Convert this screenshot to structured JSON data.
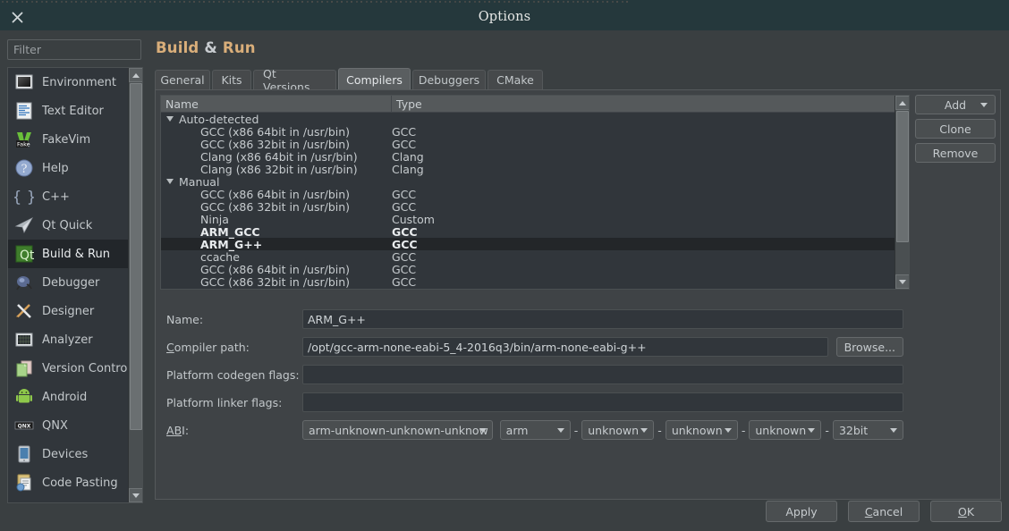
{
  "window": {
    "title": "Options",
    "close_icon": "close-icon"
  },
  "sidebar": {
    "filter_placeholder": "Filter",
    "items": [
      {
        "label": "Environment",
        "icon": "environment-icon"
      },
      {
        "label": "Text Editor",
        "icon": "text-editor-icon"
      },
      {
        "label": "FakeVim",
        "icon": "fakevim-icon"
      },
      {
        "label": "Help",
        "icon": "help-icon"
      },
      {
        "label": "C++",
        "icon": "cpp-icon"
      },
      {
        "label": "Qt Quick",
        "icon": "qt-quick-icon"
      },
      {
        "label": "Build & Run",
        "icon": "build-run-icon"
      },
      {
        "label": "Debugger",
        "icon": "debugger-icon"
      },
      {
        "label": "Designer",
        "icon": "designer-icon"
      },
      {
        "label": "Analyzer",
        "icon": "analyzer-icon"
      },
      {
        "label": "Version Control",
        "icon": "version-control-icon"
      },
      {
        "label": "Android",
        "icon": "android-icon"
      },
      {
        "label": "QNX",
        "icon": "qnx-icon"
      },
      {
        "label": "Devices",
        "icon": "devices-icon"
      },
      {
        "label": "Code Pasting",
        "icon": "code-pasting-icon"
      }
    ],
    "selected_index": 6
  },
  "page": {
    "title": "Build & Run"
  },
  "tabs": {
    "items": [
      "General",
      "Kits",
      "Qt Versions",
      "Compilers",
      "Debuggers",
      "CMake"
    ],
    "active_index": 3
  },
  "compilers_table": {
    "columns": [
      "Name",
      "Type"
    ],
    "groups": [
      {
        "label": "Auto-detected",
        "expanded": true,
        "rows": [
          {
            "name": "GCC (x86 64bit in /usr/bin)",
            "type": "GCC"
          },
          {
            "name": "GCC (x86 32bit in /usr/bin)",
            "type": "GCC"
          },
          {
            "name": "Clang (x86 64bit in /usr/bin)",
            "type": "Clang"
          },
          {
            "name": "Clang (x86 32bit in /usr/bin)",
            "type": "Clang"
          }
        ]
      },
      {
        "label": "Manual",
        "expanded": true,
        "rows": [
          {
            "name": "GCC (x86 64bit in /usr/bin)",
            "type": "GCC",
            "bold": false,
            "selected": false
          },
          {
            "name": "GCC (x86 32bit in /usr/bin)",
            "type": "GCC",
            "bold": false,
            "selected": false
          },
          {
            "name": "Ninja",
            "type": "Custom",
            "bold": false,
            "selected": false
          },
          {
            "name": "ARM_GCC",
            "type": "GCC",
            "bold": true,
            "selected": false
          },
          {
            "name": "ARM_G++",
            "type": "GCC",
            "bold": true,
            "selected": true
          },
          {
            "name": "ccache",
            "type": "GCC",
            "bold": false,
            "selected": false
          },
          {
            "name": "GCC (x86 64bit in /usr/bin)",
            "type": "GCC",
            "bold": false,
            "selected": false
          },
          {
            "name": "GCC (x86 32bit in /usr/bin)",
            "type": "GCC",
            "bold": false,
            "selected": false
          }
        ]
      }
    ]
  },
  "side_buttons": {
    "add": "Add",
    "clone": "Clone",
    "remove": "Remove"
  },
  "form": {
    "name_label": "Name:",
    "name_value": "ARM_G++",
    "compiler_path_label": "Compiler path:",
    "compiler_path_value": "/opt/gcc-arm-none-eabi-5_4-2016q3/bin/arm-none-eabi-g++",
    "browse_label": "Browse...",
    "codegen_label": "Platform codegen flags:",
    "codegen_value": "",
    "linker_label": "Platform linker flags:",
    "linker_value": "",
    "abi_label": "ABI:",
    "abi": {
      "full": "arm-unknown-unknown-unknow",
      "arch": "arm",
      "os": "unknown",
      "os_flavor": "unknown",
      "binary_format": "unknown",
      "word_width": "32bit"
    }
  },
  "footer": {
    "apply": "Apply",
    "cancel": "Cancel",
    "ok": "OK"
  },
  "colors": {
    "titlebar": "#25383c",
    "dialog_bg": "#3a3f41",
    "panel_bg": "#3f4346",
    "list_bg": "#31363b",
    "accent_heading": "#d9ae7a",
    "selection": "#232629"
  }
}
